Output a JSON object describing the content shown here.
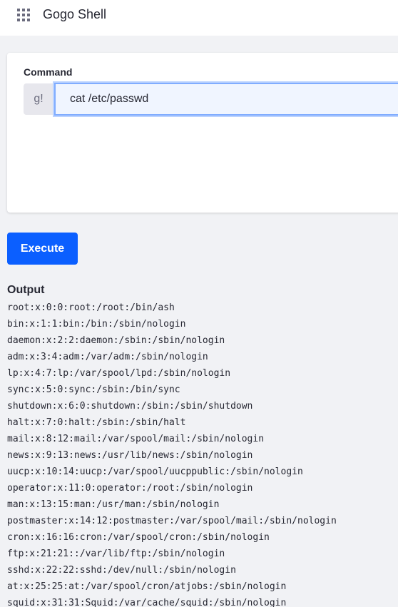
{
  "header": {
    "title": "Gogo Shell",
    "apps_icon": "apps-grid-icon"
  },
  "command": {
    "label": "Command",
    "prefix": "g!",
    "value": "cat /etc/passwd"
  },
  "execute_label": "Execute",
  "output": {
    "label": "Output",
    "lines": [
      "root:x:0:0:root:/root:/bin/ash",
      "bin:x:1:1:bin:/bin:/sbin/nologin",
      "daemon:x:2:2:daemon:/sbin:/sbin/nologin",
      "adm:x:3:4:adm:/var/adm:/sbin/nologin",
      "lp:x:4:7:lp:/var/spool/lpd:/sbin/nologin",
      "sync:x:5:0:sync:/sbin:/bin/sync",
      "shutdown:x:6:0:shutdown:/sbin:/sbin/shutdown",
      "halt:x:7:0:halt:/sbin:/sbin/halt",
      "mail:x:8:12:mail:/var/spool/mail:/sbin/nologin",
      "news:x:9:13:news:/usr/lib/news:/sbin/nologin",
      "uucp:x:10:14:uucp:/var/spool/uucppublic:/sbin/nologin",
      "operator:x:11:0:operator:/root:/sbin/nologin",
      "man:x:13:15:man:/usr/man:/sbin/nologin",
      "postmaster:x:14:12:postmaster:/var/spool/mail:/sbin/nologin",
      "cron:x:16:16:cron:/var/spool/cron:/sbin/nologin",
      "ftp:x:21:21::/var/lib/ftp:/sbin/nologin",
      "sshd:x:22:22:sshd:/dev/null:/sbin/nologin",
      "at:x:25:25:at:/var/spool/cron/atjobs:/sbin/nologin",
      "squid:x:31:31:Squid:/var/cache/squid:/sbin/nologin"
    ]
  },
  "colors": {
    "primary": "#0b5fff",
    "background": "#f1f2f5",
    "text": "#272833"
  }
}
